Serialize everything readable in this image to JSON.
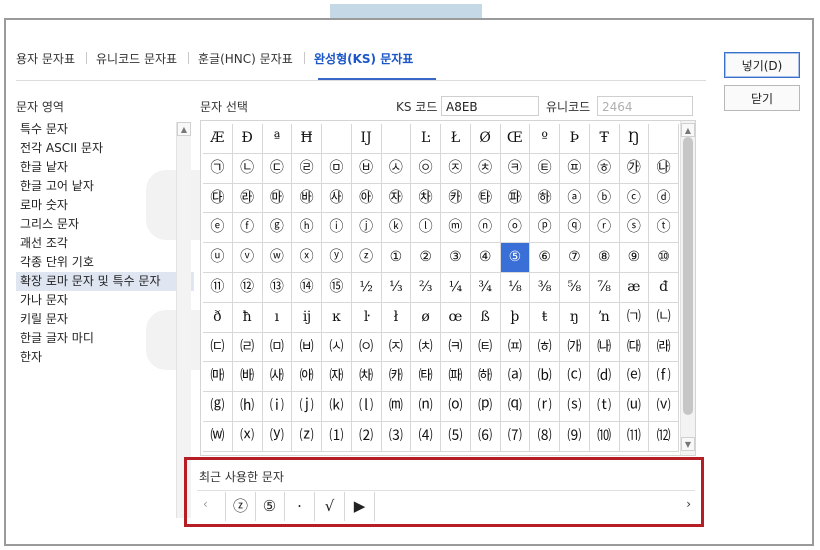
{
  "tabs": [
    {
      "label": "용자 문자표",
      "active": false
    },
    {
      "label": "유니코드 문자표",
      "active": false
    },
    {
      "label": "훈글(HNC) 문자표",
      "active": false
    },
    {
      "label": "완성형(KS) 문자표",
      "active": true
    }
  ],
  "buttons": {
    "insert": "넣기(D)",
    "close": "닫기"
  },
  "area_label": "문자 영역",
  "select_label": "문자 선택",
  "ks_code": {
    "label": "KS 코드",
    "value": "A8EB"
  },
  "unicode": {
    "label": "유니코드",
    "value": "2464"
  },
  "categories": [
    "특수 문자",
    "전각 ASCII 문자",
    "한글 낱자",
    "한글 고어 낱자",
    "로마 숫자",
    "그리스 문자",
    "괘선 조각",
    "각종 단위 기호",
    "확장 로마 문자 및 특수 문자",
    "가나 문자",
    "키릴 문자",
    "한글 글자 마디",
    "한자"
  ],
  "selected_category_index": 8,
  "grid_rows": [
    [
      "Æ",
      "Đ",
      "ª",
      "Ħ",
      "",
      "Ĳ",
      "",
      "Ŀ",
      "Ł",
      "Ø",
      "Œ",
      "º",
      "Þ",
      "Ŧ",
      "Ŋ",
      ""
    ],
    [
      "㉠",
      "㉡",
      "㉢",
      "㉣",
      "㉤",
      "㉥",
      "㉦",
      "㉧",
      "㉨",
      "㉩",
      "㉪",
      "㉫",
      "㉬",
      "㉭",
      "㉮",
      "㉯"
    ],
    [
      "㉰",
      "㉱",
      "㉲",
      "㉳",
      "㉴",
      "㉵",
      "㉶",
      "㉷",
      "㉸",
      "㉹",
      "㉺",
      "㉻",
      "ⓐ",
      "ⓑ",
      "ⓒ",
      "ⓓ"
    ],
    [
      "ⓔ",
      "ⓕ",
      "ⓖ",
      "ⓗ",
      "ⓘ",
      "ⓙ",
      "ⓚ",
      "ⓛ",
      "ⓜ",
      "ⓝ",
      "ⓞ",
      "ⓟ",
      "ⓠ",
      "ⓡ",
      "ⓢ",
      "ⓣ"
    ],
    [
      "ⓤ",
      "ⓥ",
      "ⓦ",
      "ⓧ",
      "ⓨ",
      "ⓩ",
      "①",
      "②",
      "③",
      "④",
      "⑤",
      "⑥",
      "⑦",
      "⑧",
      "⑨",
      "⑩"
    ],
    [
      "⑪",
      "⑫",
      "⑬",
      "⑭",
      "⑮",
      "½",
      "⅓",
      "⅔",
      "¼",
      "¾",
      "⅛",
      "⅜",
      "⅝",
      "⅞",
      "æ",
      "đ"
    ],
    [
      "ð",
      "ħ",
      "ı",
      "ĳ",
      "ĸ",
      "ŀ",
      "ł",
      "ø",
      "œ",
      "ß",
      "þ",
      "ŧ",
      "ŋ",
      "ŉ",
      "㈀",
      "㈁"
    ],
    [
      "㈂",
      "㈃",
      "㈄",
      "㈅",
      "㈆",
      "㈇",
      "㈈",
      "㈉",
      "㈊",
      "㈋",
      "㈌",
      "㈍",
      "㈎",
      "㈏",
      "㈐",
      "㈑"
    ],
    [
      "㈒",
      "㈓",
      "㈔",
      "㈕",
      "㈖",
      "㈗",
      "㈘",
      "㈙",
      "㈚",
      "㈛",
      "⒜",
      "⒝",
      "⒞",
      "⒟",
      "⒠",
      "⒡"
    ],
    [
      "⒢",
      "⒣",
      "⒤",
      "⒥",
      "⒦",
      "⒧",
      "⒨",
      "⒩",
      "⒪",
      "⒫",
      "⒬",
      "⒭",
      "⒮",
      "⒯",
      "⒰",
      "⒱"
    ],
    [
      "⒲",
      "⒳",
      "⒴",
      "⒵",
      "⑴",
      "⑵",
      "⑶",
      "⑷",
      "⑸",
      "⑹",
      "⑺",
      "⑻",
      "⑼",
      "⑽",
      "⑾",
      "⑿"
    ]
  ],
  "selected_cell": {
    "row": 4,
    "col": 10
  },
  "recent": {
    "label": "최근 사용한 문자",
    "chars": [
      "ⓩ",
      "⑤",
      "·",
      "√",
      "▶"
    ]
  },
  "colors": {
    "accent": "#3a6fd8",
    "highlight_border": "#b51e24"
  }
}
